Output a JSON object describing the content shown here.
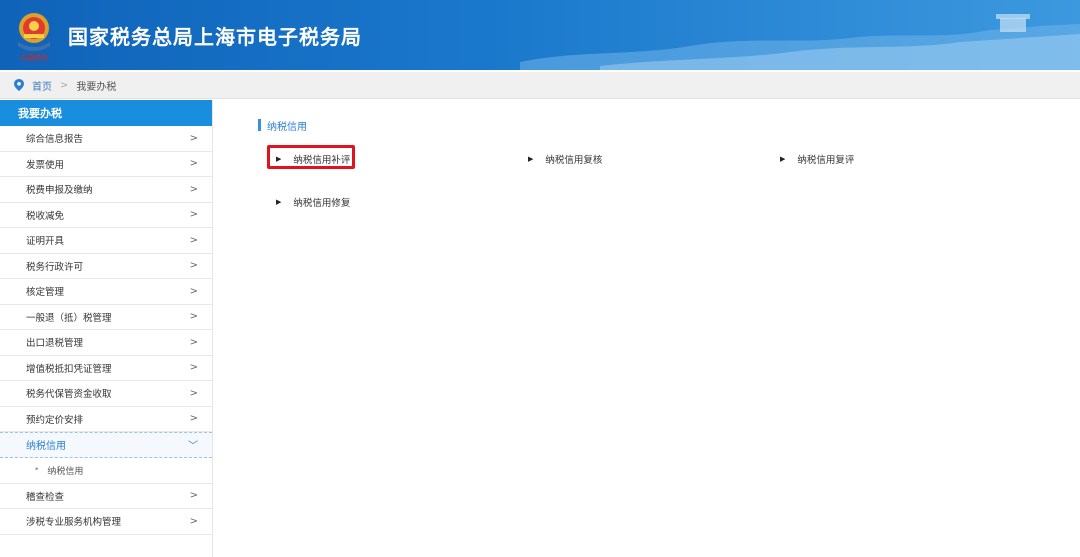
{
  "header": {
    "site_title": "国家税务总局上海市电子税务局",
    "emblem_caption": "中国税务"
  },
  "breadcrumb": {
    "home": "首页",
    "separator": ">",
    "current": "我要办税"
  },
  "sidebar": {
    "heading": "我要办税",
    "items": [
      {
        "label": "综合信息报告",
        "chevron": ">"
      },
      {
        "label": "发票使用",
        "chevron": ">"
      },
      {
        "label": "税费申报及缴纳",
        "chevron": ">"
      },
      {
        "label": "税收减免",
        "chevron": ">"
      },
      {
        "label": "证明开具",
        "chevron": ">"
      },
      {
        "label": "税务行政许可",
        "chevron": ">"
      },
      {
        "label": "核定管理",
        "chevron": ">"
      },
      {
        "label": "一般退（抵）税管理",
        "chevron": ">"
      },
      {
        "label": "出口退税管理",
        "chevron": ">"
      },
      {
        "label": "增值税抵扣凭证管理",
        "chevron": ">"
      },
      {
        "label": "税务代保管资金收取",
        "chevron": ">"
      },
      {
        "label": "预约定价安排",
        "chevron": ">"
      }
    ],
    "active_item": {
      "label": "纳税信用",
      "chevron": "﹀"
    },
    "sub_item": {
      "bullet": "•",
      "label": "纳税信用"
    },
    "after_items": [
      {
        "label": "稽查检查",
        "chevron": ">"
      },
      {
        "label": "涉税专业服务机构管理",
        "chevron": ">"
      }
    ]
  },
  "main": {
    "section_title": "纳税信用",
    "links": [
      {
        "label": "纳税信用补评",
        "bullet": "▶"
      },
      {
        "label": "纳税信用复核",
        "bullet": "▶"
      },
      {
        "label": "纳税信用复评",
        "bullet": "▶"
      },
      {
        "label": "纳税信用修复",
        "bullet": "▶"
      }
    ]
  },
  "colors": {
    "header_blue": "#1a78cc",
    "sidebar_head": "#1a8ede",
    "accent": "#2a7fd0",
    "highlight": "#e0141e"
  }
}
